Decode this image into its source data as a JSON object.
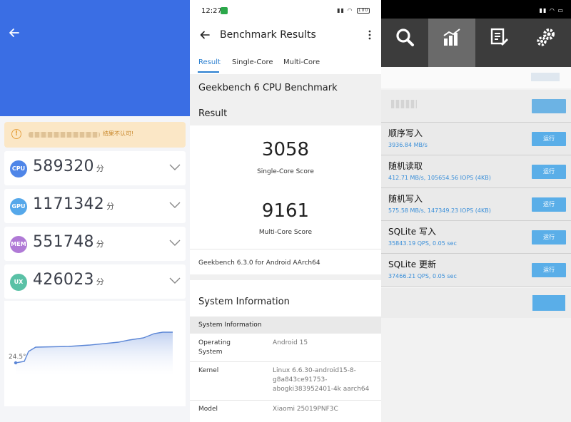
{
  "left": {
    "warning_text": "结果不认可!",
    "temperature_label": "24.5°",
    "scores": [
      {
        "badge": "CPU",
        "value": "589320",
        "unit": "分",
        "color": "#4f86e8"
      },
      {
        "badge": "GPU",
        "value": "1171342",
        "unit": "分",
        "color": "#56a8ea"
      },
      {
        "badge": "MEM",
        "value": "551748",
        "unit": "分",
        "color": "#b07ad6"
      },
      {
        "badge": "UX",
        "value": "426023",
        "unit": "分",
        "color": "#5ac1a6"
      }
    ],
    "colors": {
      "header": "#3a6ee4",
      "warning_bg": "#fbe7c6",
      "chart_line": "#5b86d6"
    }
  },
  "middle": {
    "status": {
      "time": "12:27",
      "battery": "100"
    },
    "title": "Benchmark Results",
    "tabs": [
      "Result",
      "Single-Core",
      "Multi-Core"
    ],
    "active_tab": "Result",
    "benchmark_title": "Geekbench 6 CPU Benchmark",
    "result_heading": "Result",
    "single_core": {
      "score": "3058",
      "caption": "Single-Core Score"
    },
    "multi_core": {
      "score": "9161",
      "caption": "Multi-Core Score"
    },
    "version": "Geekbench 6.3.0 for Android AArch64",
    "system_info_title": "System Information",
    "system_info_header": "System Information",
    "info": [
      {
        "key": "Operating System",
        "value": "Android 15"
      },
      {
        "key": "Kernel",
        "value": "Linux 6.6.30-android15-8-g8a843ce91753-abogki383952401-4k aarch64"
      },
      {
        "key": "Model",
        "value": "Xiaomi 25019PNF3C"
      }
    ],
    "colors": {
      "accent": "#2a7fd0"
    }
  },
  "right": {
    "tools": [
      {
        "icon": "search-icon",
        "active": false
      },
      {
        "icon": "bar-chart-icon",
        "active": true
      },
      {
        "icon": "document-edit-icon",
        "active": false
      },
      {
        "icon": "gears-icon",
        "active": false
      }
    ],
    "benchmarks": [
      {
        "name": "顺序写入",
        "result": "3936.84 MB/s",
        "button": "运行"
      },
      {
        "name": "随机读取",
        "result": "412.71 MB/s, 105654.56 IOPS (4KB)",
        "button": "运行"
      },
      {
        "name": "随机写入",
        "result": "575.58 MB/s, 147349.23 IOPS (4KB)",
        "button": "运行"
      },
      {
        "name": "SQLite 写入",
        "result": "35843.19 QPS, 0.05 sec",
        "button": "运行"
      },
      {
        "name": "SQLite 更新",
        "result": "37466.21 QPS, 0.05 sec",
        "button": "运行"
      }
    ],
    "colors": {
      "button": "#5aaee8",
      "result_text": "#3a8fd9",
      "toolbar": "#3c3c3c"
    }
  }
}
